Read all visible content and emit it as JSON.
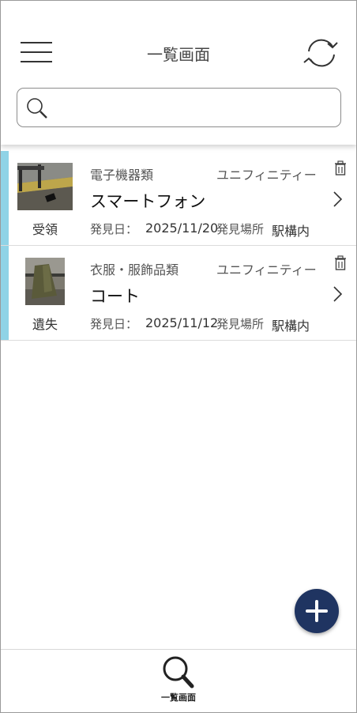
{
  "header": {
    "title": "一覧画面"
  },
  "search": {
    "value": "",
    "placeholder": ""
  },
  "items": [
    {
      "status": "受領",
      "category": "電子機器類",
      "store": "ユニフィニティー",
      "name": "スマートフォン",
      "date_label": "発見日：",
      "date": "2025/11/20",
      "place_label": "発見場所",
      "place": "駅構内"
    },
    {
      "status": "遺失",
      "category": "衣服・服飾品類",
      "store": "ユニフィニティー",
      "name": "コート",
      "date_label": "発見日：",
      "date": "2025/11/12",
      "place_label": "発見場所",
      "place": "駅構内"
    }
  ],
  "bottom_nav": {
    "tab_label": "一覧画面"
  },
  "colors": {
    "accent_bar": "#8fd3e6",
    "fab": "#1f3461"
  },
  "icons": [
    "menu-icon",
    "refresh-icon",
    "search-icon",
    "trash-icon",
    "chevron-right-icon",
    "plus-icon"
  ]
}
